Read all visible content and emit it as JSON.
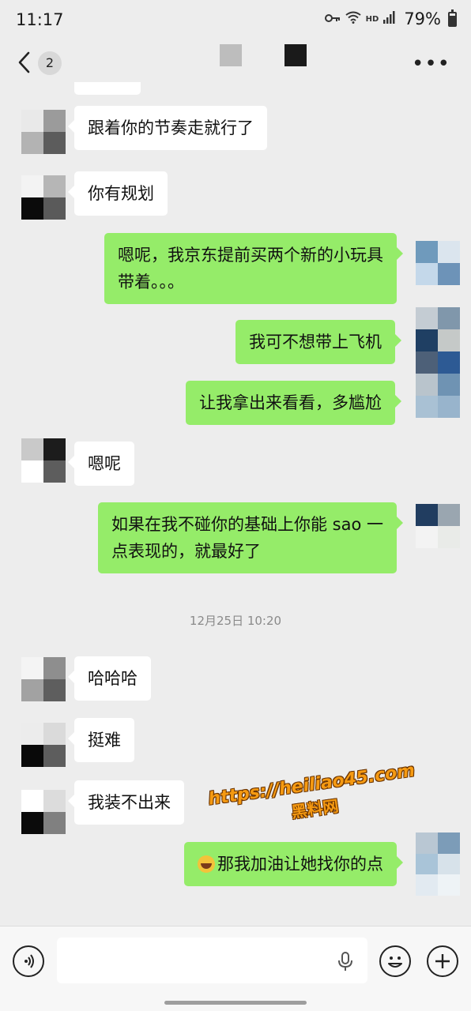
{
  "status_bar": {
    "time": "11:17",
    "network": "HD",
    "battery_percent": "79%",
    "battery_level": 0.79
  },
  "header": {
    "unread_count": "2"
  },
  "messages": [
    {
      "side": "left",
      "text": "跟着你的节奏走就行了"
    },
    {
      "side": "left",
      "text": "你有规划"
    },
    {
      "side": "right",
      "text": "嗯呢，我京东提前买两个新的小玩具\n带着。。。"
    },
    {
      "side": "right",
      "text": "我可不想带上飞机"
    },
    {
      "side": "right",
      "text": "让我拿出来看看，多尴尬"
    },
    {
      "side": "left",
      "text": "嗯呢"
    },
    {
      "side": "right",
      "text": "如果在我不碰你的基础上你能 sao 一\n点表现的，就最好了"
    },
    {
      "side": "left",
      "text": "哈哈哈"
    },
    {
      "side": "left",
      "text": "挺难"
    },
    {
      "side": "left",
      "text": "我装不出来"
    },
    {
      "side": "right",
      "text": "那我加油让她找你的点",
      "emoji": "rolling-on-floor-laughing"
    }
  ],
  "timestamp": "12月25日 10:20",
  "watermark": {
    "url": "https://heiliao45.com",
    "name": "黑料网"
  },
  "input_bar": {
    "text_value": ""
  },
  "colors": {
    "background": "#ededed",
    "incoming_bubble": "#ffffff",
    "outgoing_bubble": "#95ec69",
    "timestamp_text": "#8a8a8a"
  }
}
